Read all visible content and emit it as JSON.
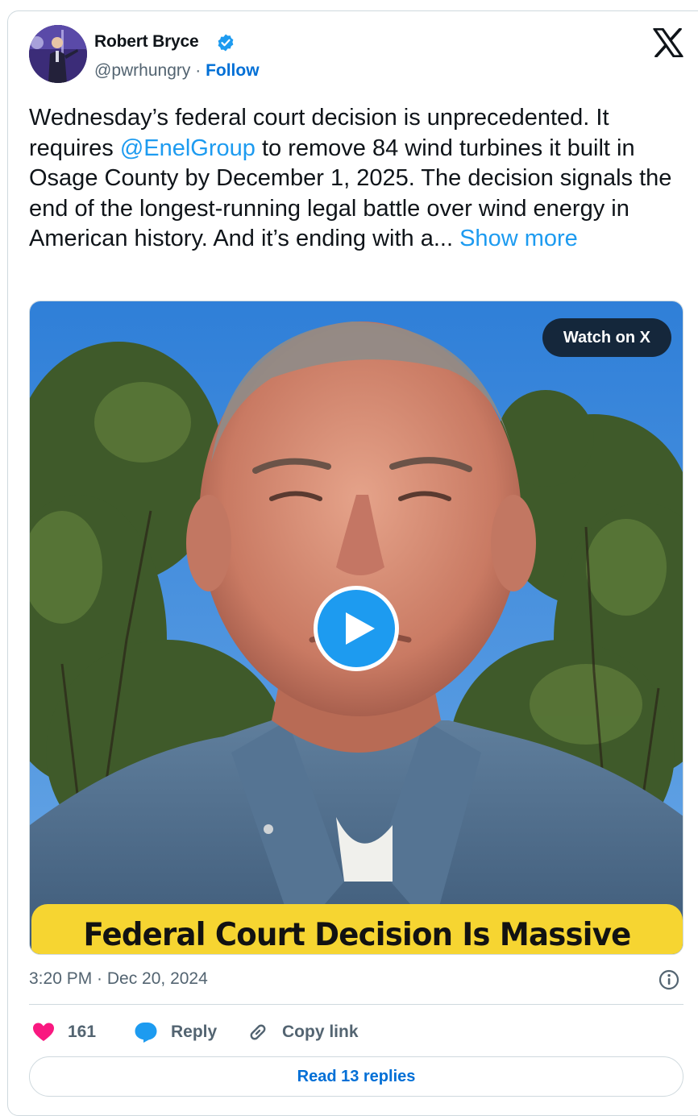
{
  "author": {
    "name": "Robert Bryce",
    "handle": "@pwrhungry",
    "separator": "·",
    "follow_label": "Follow",
    "avatar_icon": "profile-photo"
  },
  "brand_icon": "x-logo",
  "tweet": {
    "text_before": "Wednesday’s federal court decision is unprecedented. It requires ",
    "mention": "@EnelGroup",
    "text_after": "  to remove 84 wind turbines it built in Osage County by December 1, 2025. The decision signals the end of the longest-running legal battle over wind energy in American history. And it’s ending with a... ",
    "show_more": "Show more"
  },
  "media": {
    "watch_label": "Watch on X",
    "banner_text": "Federal Court Decision Is Massive Win",
    "play_icon": "play-icon"
  },
  "meta": {
    "timestamp": "3:20 PM · Dec 20, 2024"
  },
  "actions": {
    "like_count": "161",
    "reply_label": "Reply",
    "copy_link_label": "Copy link"
  },
  "footer": {
    "read_replies_label": "Read 13 replies"
  },
  "colors": {
    "accent": "#1d9bf0",
    "link": "#006fd6",
    "like": "#f91880",
    "muted": "#536471",
    "banner": "#f6d531"
  }
}
